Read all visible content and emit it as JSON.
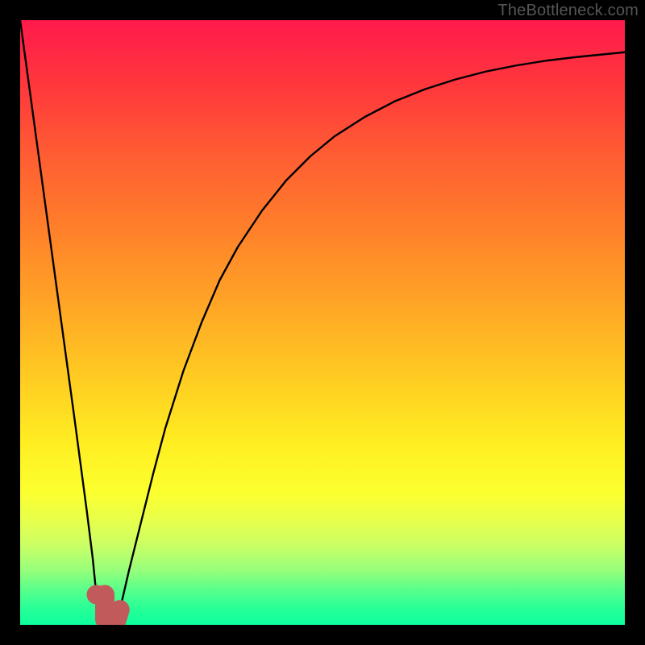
{
  "watermark": {
    "text": "TheBottleneck.com"
  },
  "chart_data": {
    "type": "line",
    "title": "",
    "xlabel": "",
    "ylabel": "",
    "xlim": [
      0,
      100
    ],
    "ylim": [
      0,
      100
    ],
    "grid": false,
    "legend": false,
    "series": [
      {
        "name": "bottleneck-curve",
        "color": "#000000",
        "x": [
          0,
          3,
          6,
          9,
          11,
          12,
          12.6,
          13.2,
          14,
          15,
          15.9,
          16.5,
          18,
          20,
          22,
          24,
          27,
          30,
          33,
          36,
          40,
          44,
          48,
          52,
          57,
          62,
          67,
          72,
          77,
          82,
          87,
          92,
          97,
          100
        ],
        "values": [
          100,
          78,
          56,
          34,
          19,
          11,
          5,
          2,
          0.5,
          0,
          0.5,
          2.5,
          9,
          17,
          25,
          32.5,
          42,
          50,
          57,
          62.5,
          68.5,
          73.5,
          77.5,
          80.8,
          84,
          86.6,
          88.6,
          90.2,
          91.5,
          92.5,
          93.3,
          93.9,
          94.4,
          94.7
        ]
      }
    ],
    "markers": [
      {
        "name": "marker-dot",
        "shape": "circle",
        "cx": 12.6,
        "cy": 5,
        "r": 1.6,
        "color": "#c15b5b"
      },
      {
        "name": "marker-j-shape",
        "shape": "round-stroke",
        "points": [
          [
            14,
            5
          ],
          [
            14,
            0.9
          ],
          [
            15,
            0.7
          ],
          [
            15.9,
            0.6
          ],
          [
            16.5,
            2.5
          ]
        ],
        "width": 3.2,
        "color": "#c15b5b"
      }
    ],
    "background": {
      "type": "vertical-gradient",
      "stops": [
        {
          "pos": 0,
          "color": "#ff1a4b"
        },
        {
          "pos": 20,
          "color": "#ff5c33"
        },
        {
          "pos": 45,
          "color": "#ffa226"
        },
        {
          "pos": 70,
          "color": "#ffee22"
        },
        {
          "pos": 86,
          "color": "#c8ff66"
        },
        {
          "pos": 100,
          "color": "#0cff9e"
        }
      ]
    }
  }
}
